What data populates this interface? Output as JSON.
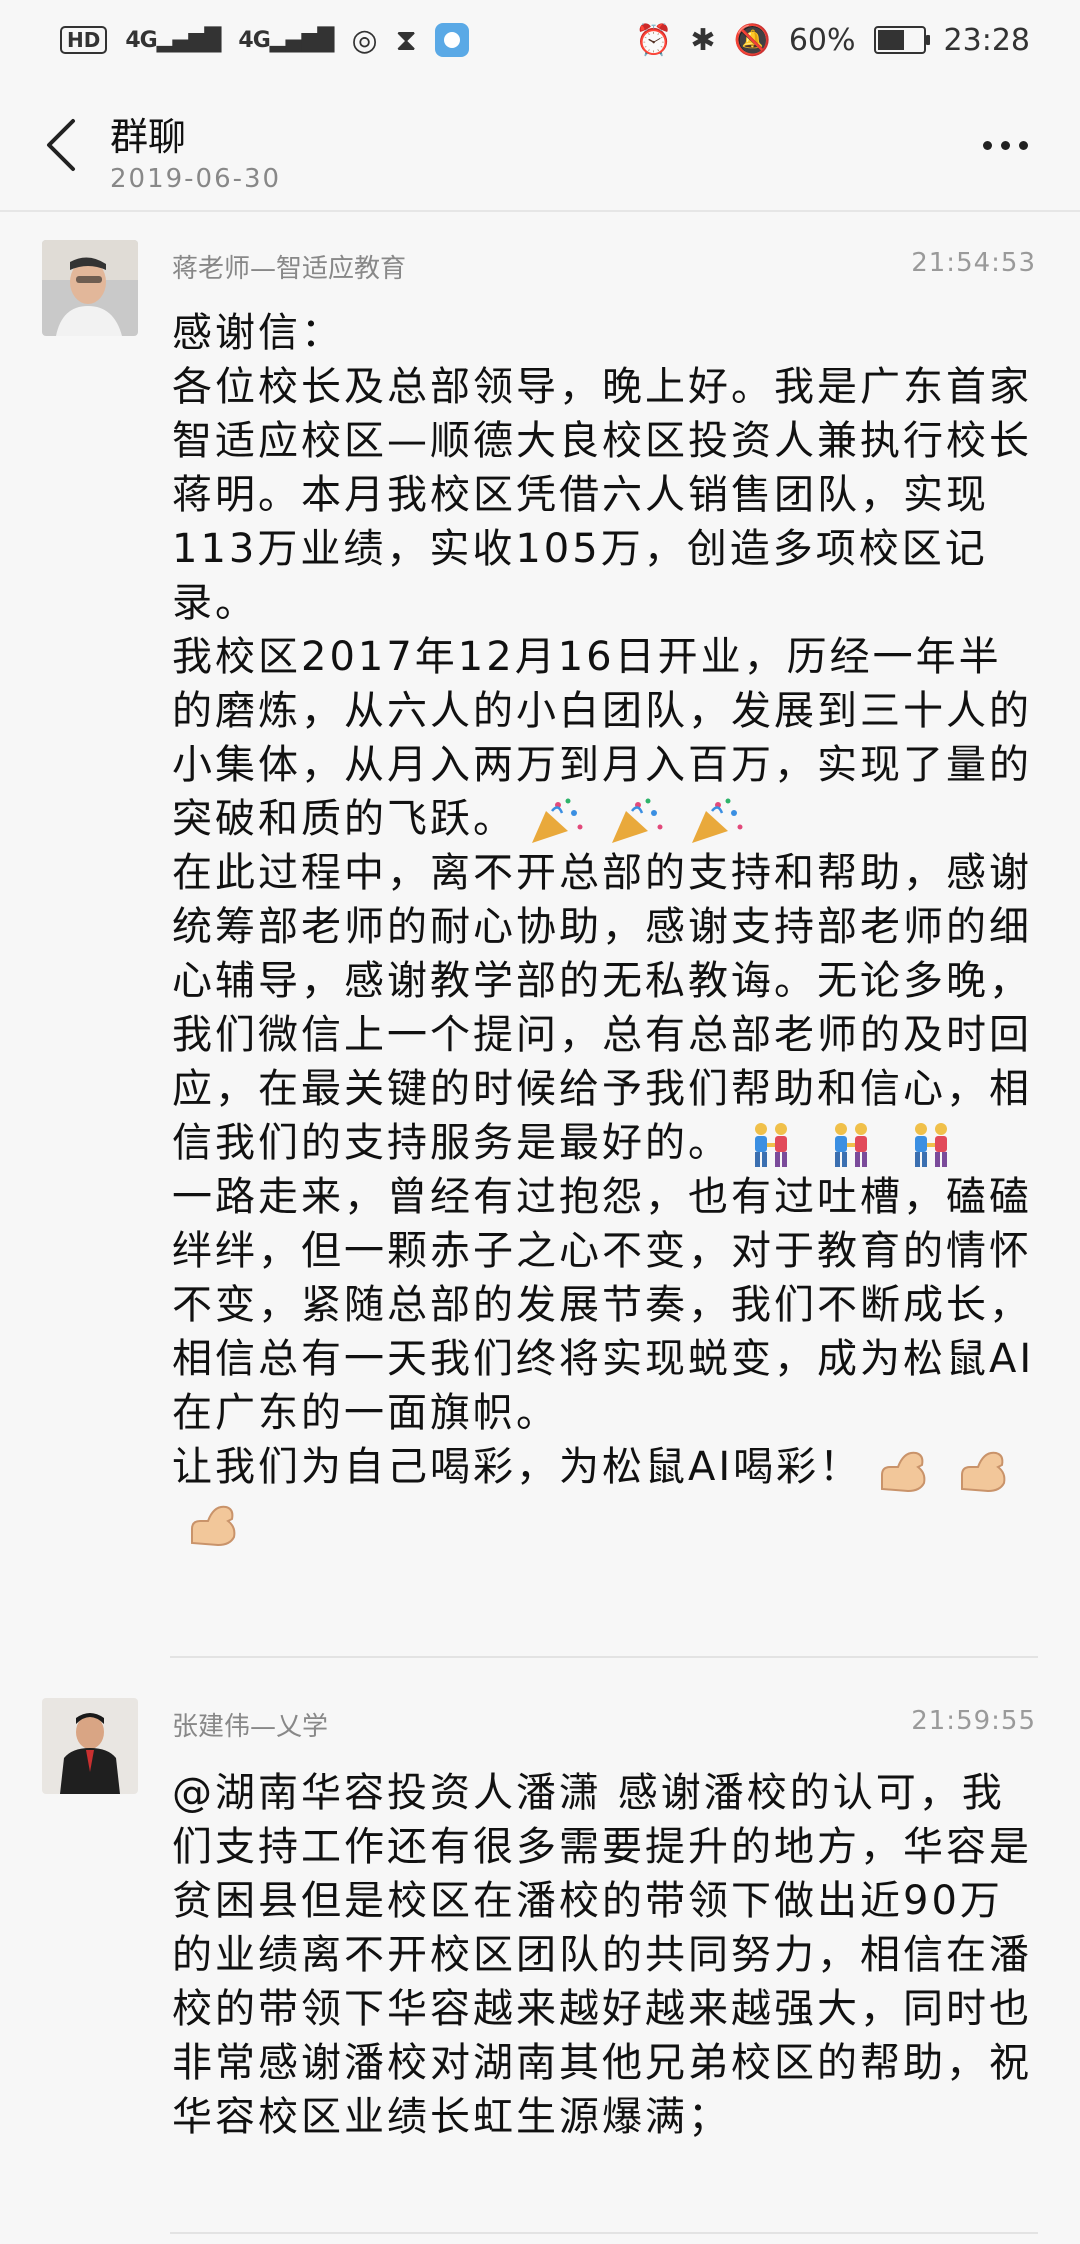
{
  "status_bar": {
    "hd": "HD",
    "signal1": "4G",
    "signal2": "4G",
    "battery_text": "60%",
    "battery_level": 0.6,
    "clock": "23:28"
  },
  "header": {
    "title": "群聊",
    "date": "2019-06-30"
  },
  "messages": [
    {
      "sender": "蒋老师—智适应教育",
      "time": "21:54:53",
      "paragraphs": {
        "p1": "感谢信：",
        "p2": "各位校长及总部领导，晚上好。我是广东首家智适应校区—顺德大良校区投资人兼执行校长蒋明。本月我校区凭借六人销售团队，实现113万业绩，实收105万，创造多项校区记录。",
        "p3": "我校区2017年12月16日开业，历经一年半的磨炼，从六人的小白团队，发展到三十人的小集体，从月入两万到月入百万，实现了量的突破和质的飞跃。",
        "p4": "在此过程中，离不开总部的支持和帮助，感谢统筹部老师的耐心协助，感谢支持部老师的细心辅导，感谢教学部的无私教诲。无论多晚，我们微信上一个提问，总有总部老师的及时回应，在最关键的时候给予我们帮助和信心，相信我们的支持服务是最好的。",
        "p5": "一路走来，曾经有过抱怨，也有过吐槽，磕磕绊绊，但一颗赤子之心不变，对于教育的情怀不变，紧随总部的发展节奏，我们不断成长，相信总有一天我们终将实现蜕变，成为松鼠AI在广东的一面旗帜。",
        "p6": "让我们为自己喝彩，为松鼠AI喝彩！"
      }
    },
    {
      "sender": "张建伟—乂学",
      "time": "21:59:55",
      "paragraphs": {
        "p1": "@湖南华容投资人潘潇 感谢潘校的认可，我们支持工作还有很多需要提升的地方，华容是贫困县但是校区在潘校的带领下做出近90万的业绩离不开校区团队的共同努力，相信在潘校的带领下华容越来越好越来越强大，同时也非常感谢潘校对湖南其他兄弟校区的帮助，祝华容校区业绩长虹生源爆满；"
      }
    }
  ],
  "icons": {
    "back": "back-arrow-icon",
    "more": "more-dots-icon",
    "party": "party-popper-icon",
    "couple": "couple-holding-hands-icon",
    "muscle": "flexed-biceps-icon"
  }
}
